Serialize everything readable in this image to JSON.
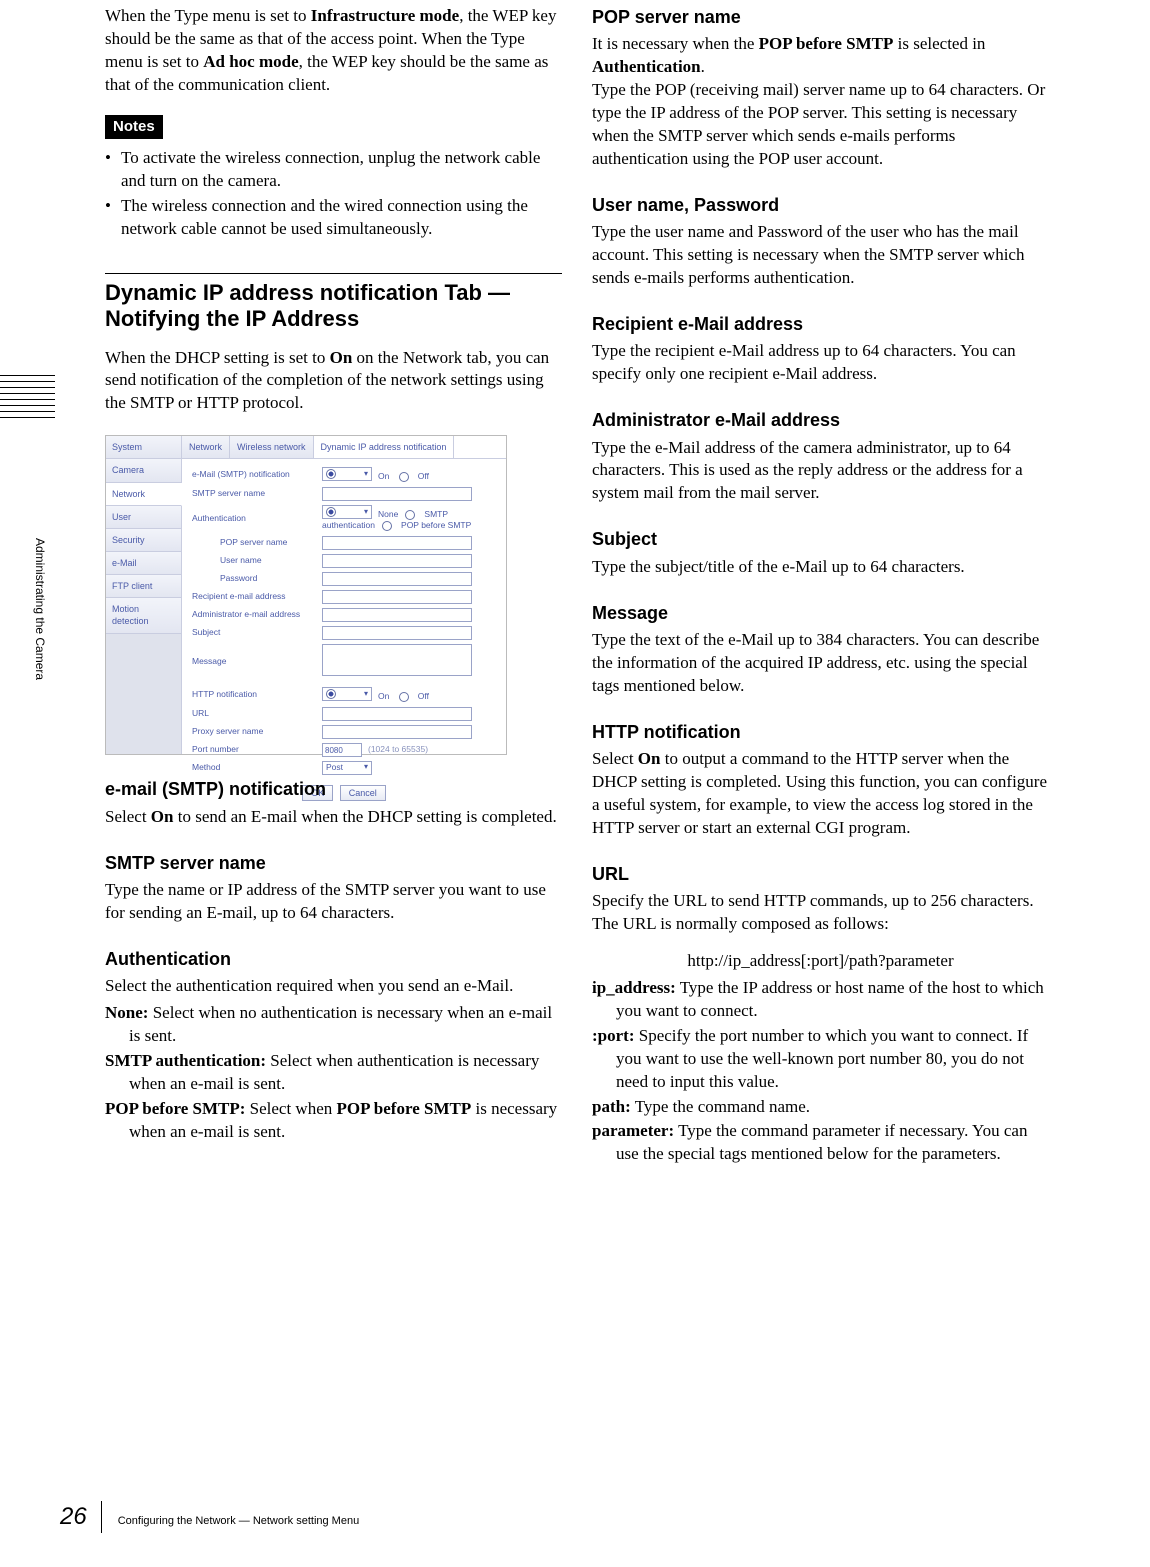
{
  "sidebar_text": "Administrating the Camera",
  "page_number": "26",
  "footer_text": "Configuring the Network — Network setting Menu",
  "col1": {
    "intro_para": "When the Type menu is set to <b>Infrastructure mode</b>, the WEP key should be the same as that of the access point. When the Type menu is set to <b>Ad hoc mode</b>, the WEP key should be the same as that of the communication client.",
    "notes_label": "Notes",
    "notes": [
      "To activate the wireless connection, unplug the network cable and turn on the camera.",
      "The wireless connection and the wired connection using the network cable cannot be used simultaneously."
    ],
    "section_heading": "Dynamic IP address notification Tab — Notifying the IP Address",
    "section_intro": "When the DHCP setting is set to <b>On</b> on the Network tab, you can send notification of the completion of the network settings using the SMTP or HTTP protocol.",
    "smtp_h": "e-mail (SMTP) notification",
    "smtp_p": "Select <b>On</b> to send an E-mail when the DHCP setting is completed.",
    "smtpsrv_h": "SMTP server name",
    "smtpsrv_p": "Type the name or IP address of the SMTP server you want to use for sending an E-mail, up to 64 characters.",
    "auth_h": "Authentication",
    "auth_p": "Select the authentication required when you send an e-Mail.",
    "auth_defs": [
      {
        "term": "None:",
        "desc": "Select when no authentication is necessary when an e-mail is sent."
      },
      {
        "term": "SMTP authentication:",
        "desc": "Select when authentication is necessary when an e-mail is sent."
      },
      {
        "term": "POP before SMTP:",
        "desc": "Select when <b>POP before SMTP</b> is necessary when an e-mail is sent."
      }
    ]
  },
  "col2": {
    "pop_h": "POP server name",
    "pop_p": "It is necessary when the <b>POP before SMTP</b> is selected in <b>Authentication</b>.<br>Type the POP (receiving mail) server name up to 64 characters. Or type the IP address of the POP server. This setting is necessary when the SMTP server which sends e-mails performs authentication using the POP user account.",
    "user_h": "User name, Password",
    "user_p": "Type the user name and Password of the user who has the mail account. This setting is necessary when the SMTP server which sends e-mails performs authentication.",
    "recip_h": "Recipient e-Mail address",
    "recip_p": "Type the recipient e-Mail address up to 64 characters. You can specify only one recipient e-Mail address.",
    "admin_h": "Administrator e-Mail address",
    "admin_p": "Type the e-Mail address of the camera administrator, up to 64 characters.  This is used as the reply address or the address for a system mail from the mail server.",
    "subj_h": "Subject",
    "subj_p": "Type the subject/title of the e-Mail up to 64 characters.",
    "msg_h": "Message",
    "msg_p": "Type the text of the e-Mail up to 384 characters.  You can describe the information of the acquired IP address, etc. using the special tags mentioned below.",
    "http_h": "HTTP notification",
    "http_p": "Select <b>On</b> to output a command to the HTTP server when the DHCP setting is completed.  Using this function, you can configure a useful system, for example, to view the access log stored in the HTTP server or start an external CGI program.",
    "url_h": "URL",
    "url_p": "Specify the URL to send HTTP commands, up to 256 characters.  The URL is normally composed as follows:",
    "url_example": "http://ip_address[:port]/path?parameter",
    "url_defs": [
      {
        "term": "ip_address:",
        "desc": "Type the IP address or host name of the host to which you want to connect."
      },
      {
        "term": ":port:",
        "desc": "Specify the port number to which you want to connect.  If you want to use the well-known port number 80, you do not need to input this value."
      },
      {
        "term": "path:",
        "desc": "Type the command name."
      },
      {
        "term": "parameter:",
        "desc": "Type the command parameter if necessary. You can use the special tags mentioned below for the parameters."
      }
    ]
  },
  "shot": {
    "nav": [
      "System",
      "Camera",
      "Network",
      "User",
      "Security",
      "e-Mail",
      "FTP client",
      "Motion detection"
    ],
    "nav_active_index": 2,
    "tabs": [
      "Network",
      "Wireless network",
      "Dynamic IP address notification"
    ],
    "tab_active_index": 2,
    "rows": {
      "email_notif_label": "e-Mail (SMTP) notification",
      "on": "On",
      "off": "Off",
      "smtp_server": "SMTP server name",
      "auth": "Authentication",
      "auth_none": "None",
      "auth_smtp": "SMTP authentication",
      "auth_pop": "POP before SMTP",
      "pop_server": "POP server name",
      "user_name": "User name",
      "password": "Password",
      "recip": "Recipient e-mail address",
      "admin": "Administrator e-mail address",
      "subject": "Subject",
      "message": "Message",
      "http_notif": "HTTP notification",
      "url": "URL",
      "proxy": "Proxy server name",
      "port": "Port number",
      "port_value": "8080",
      "port_hint": "(1024 to 65535)",
      "method": "Method",
      "method_value": "Post",
      "ok": "OK",
      "cancel": "Cancel"
    }
  }
}
